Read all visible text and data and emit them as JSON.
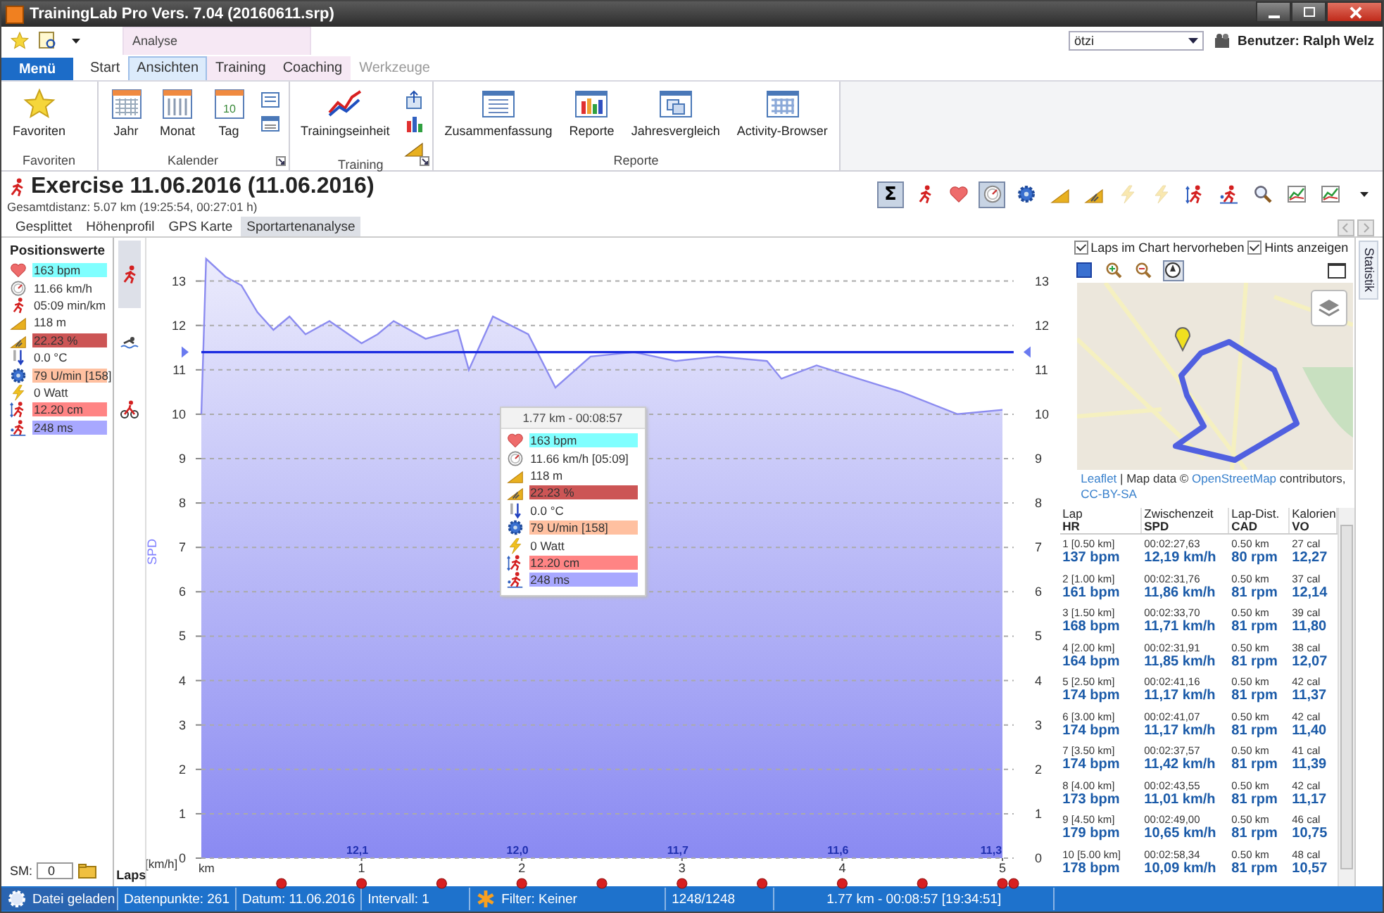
{
  "window": {
    "title": "TrainingLab Pro Vers. 7.04 (20160611.srp)"
  },
  "ribbon": {
    "context_group": "Analyse",
    "menu_button": "Menü",
    "tabs": [
      {
        "label": "Start",
        "selected": false,
        "disabled": false
      },
      {
        "label": "Ansichten",
        "selected": true,
        "disabled": false
      },
      {
        "label": "Training",
        "selected": false,
        "disabled": false
      },
      {
        "label": "Coaching",
        "selected": false,
        "disabled": false
      },
      {
        "label": "Werkzeuge",
        "selected": false,
        "disabled": true
      }
    ],
    "athlete_select": {
      "value": "ötzi"
    },
    "user": "Benutzer: Ralph Welz",
    "groups": [
      {
        "title": "Favoriten",
        "launcher": false,
        "buttons": [
          {
            "kind": "star",
            "label": "Favoriten"
          }
        ]
      },
      {
        "title": "Kalender",
        "launcher": true,
        "buttons": [
          {
            "kind": "year",
            "label": "Jahr"
          },
          {
            "kind": "month",
            "label": "Monat"
          },
          {
            "kind": "day",
            "label": "Tag",
            "icon_text": "10"
          }
        ],
        "small_buttons": [
          {
            "kind": "list"
          },
          {
            "kind": "week"
          }
        ]
      },
      {
        "title": "Training",
        "launcher": true,
        "buttons": [
          {
            "kind": "training",
            "label": "Trainingseinheit"
          }
        ],
        "small_buttons": [
          {
            "kind": "upload"
          },
          {
            "kind": "bars"
          },
          {
            "kind": "slope"
          }
        ]
      },
      {
        "title": "Reporte",
        "launcher": false,
        "buttons": [
          {
            "kind": "summary",
            "label": "Zusammenfassung"
          },
          {
            "kind": "reports",
            "label": "Reporte"
          },
          {
            "kind": "compare",
            "label": "Jahresvergleich"
          },
          {
            "kind": "browser",
            "label": "Activity-Browser"
          }
        ]
      }
    ]
  },
  "heading": {
    "title": "Exercise 11.06.2016 (11.06.2016)",
    "subtitle": "Gesamtdistanz: 5.07 km (19:25:54, 00:27:01 h)"
  },
  "toolbar": [
    {
      "kind": "sum",
      "label": "Σ",
      "selected": true,
      "disabled": false
    },
    {
      "kind": "run",
      "selected": false,
      "disabled": false
    },
    {
      "kind": "heart",
      "selected": false,
      "disabled": false
    },
    {
      "kind": "speed",
      "selected": true,
      "disabled": false
    },
    {
      "kind": "cadence",
      "selected": false,
      "disabled": false
    },
    {
      "kind": "altitude",
      "selected": false,
      "disabled": false
    },
    {
      "kind": "slope",
      "selected": false,
      "disabled": false
    },
    {
      "kind": "power",
      "selected": false,
      "disabled": true
    },
    {
      "kind": "power",
      "selected": false,
      "disabled": true
    },
    {
      "kind": "stride",
      "selected": false,
      "disabled": false
    },
    {
      "kind": "contact",
      "selected": false,
      "disabled": false
    },
    {
      "kind": "zoom",
      "selected": false,
      "disabled": false
    },
    {
      "kind": "chart",
      "selected": false,
      "disabled": false
    },
    {
      "kind": "chart",
      "selected": false,
      "disabled": false
    },
    {
      "kind": "more",
      "selected": false,
      "disabled": false
    }
  ],
  "view_tabs": [
    {
      "label": "Gesplittet",
      "selected": false
    },
    {
      "label": "Höhenprofil",
      "selected": false
    },
    {
      "label": "GPS Karte",
      "selected": false
    },
    {
      "label": "Sportartenanalyse",
      "selected": true
    }
  ],
  "position_values": {
    "title": "Positionswerte",
    "rows": [
      {
        "kind": "heart",
        "value": "163 bpm",
        "color": "#80ffff"
      },
      {
        "kind": "speed",
        "value": "11.66 km/h"
      },
      {
        "kind": "pace",
        "value": "05:09 min/km"
      },
      {
        "kind": "altitude",
        "value": "118 m"
      },
      {
        "kind": "slope",
        "value": "22.23 %",
        "color": "#cc5555"
      },
      {
        "kind": "temp",
        "value": "0.0 °C"
      },
      {
        "kind": "cadence",
        "value": "79 U/min [158]",
        "color": "#ffc0a0"
      },
      {
        "kind": "power",
        "value": "0 Watt"
      },
      {
        "kind": "stride",
        "value": "12.20 cm",
        "color": "#ff8484"
      },
      {
        "kind": "contact",
        "value": "248 ms",
        "color": "#a8a8ff"
      }
    ]
  },
  "sm": {
    "label": "SM:",
    "value": "0"
  },
  "sport_filters": [
    {
      "kind": "run",
      "selected": true
    },
    {
      "kind": "swim",
      "selected": false
    },
    {
      "kind": "bike",
      "selected": false
    }
  ],
  "chart": {
    "unit_label": "[km/h]",
    "laps_label": "Laps",
    "right_ticks": [
      "13",
      "12",
      "11",
      "10",
      "9",
      "8",
      "7",
      "6",
      "5",
      "4",
      "3",
      "2",
      "1",
      "0"
    ],
    "segment_averages": [
      "12,1",
      "12,0",
      "11,7",
      "11,6",
      "11,3"
    ],
    "chart_data": {
      "type": "line",
      "xlabel": "km",
      "ylabel": "SPD",
      "x": [
        0,
        0.03,
        0.15,
        0.25,
        0.35,
        0.45,
        0.55,
        0.65,
        0.8,
        1.0,
        1.1,
        1.2,
        1.4,
        1.6,
        1.67,
        1.82,
        2.04,
        2.21,
        2.43,
        2.7,
        2.96,
        3.22,
        3.53,
        3.62,
        3.84,
        4.1,
        4.37,
        4.72,
        5.0
      ],
      "series": [
        {
          "color": "#8c8cf0",
          "values": [
            10.0,
            13.5,
            13.1,
            12.9,
            12.3,
            11.9,
            12.2,
            11.8,
            12.1,
            11.6,
            11.8,
            12.1,
            11.7,
            11.9,
            11.0,
            12.2,
            11.8,
            10.6,
            11.3,
            11.4,
            11.2,
            11.3,
            11.2,
            10.8,
            11.1,
            10.8,
            10.5,
            10.0,
            10.1
          ]
        }
      ],
      "xlim": [
        0,
        5.07
      ],
      "ylim": [
        0,
        13.5
      ],
      "grid": true,
      "xticks": [
        1,
        2,
        3,
        4,
        5
      ],
      "yticks": [
        0,
        1,
        2,
        3,
        4,
        5,
        6,
        7,
        8,
        9,
        10,
        11,
        12,
        13
      ],
      "ref_lines": [
        {
          "axis": "y",
          "value": 11.4
        }
      ]
    }
  },
  "tooltip": {
    "title": "1.77 km - 00:08:57",
    "rows": [
      {
        "kind": "heart",
        "value": "163 bpm",
        "color": "#80ffff"
      },
      {
        "kind": "speed",
        "value": "11.66 km/h [05:09]"
      },
      {
        "kind": "altitude",
        "value": "118 m"
      },
      {
        "kind": "slope",
        "value": "22.23 %",
        "color": "#cc5555"
      },
      {
        "kind": "temp",
        "value": "0.0 °C"
      },
      {
        "kind": "cadence",
        "value": "79 U/min [158]",
        "color": "#ffc0a0"
      },
      {
        "kind": "power",
        "value": "0 Watt"
      },
      {
        "kind": "stride",
        "value": "12.20 cm",
        "color": "#ff8484"
      },
      {
        "kind": "contact",
        "value": "248 ms",
        "color": "#a8a8ff"
      }
    ]
  },
  "laps_panel": {
    "options": [
      {
        "label": "Laps im Chart hervorheben",
        "checked": true
      },
      {
        "label": "Hints anzeigen",
        "checked": true
      }
    ],
    "map_tools": [
      {
        "kind": "select",
        "selected": false
      },
      {
        "kind": "zoom-in",
        "selected": false
      },
      {
        "kind": "zoom-out",
        "selected": false
      },
      {
        "kind": "compass",
        "selected": true
      }
    ],
    "map_attribution": [
      {
        "text": "Leaflet",
        "link": true
      },
      {
        "text": " | Map data © ",
        "link": false
      },
      {
        "text": "OpenStreetMap",
        "link": true
      },
      {
        "text": " contributors, ",
        "link": false
      },
      {
        "text": "CC-BY-SA",
        "link": true
      }
    ],
    "table": {
      "columns": [
        {
          "top": "Lap",
          "bottom": "HR"
        },
        {
          "top": "Zwischenzeit",
          "bottom": "SPD"
        },
        {
          "top": "Lap-Dist.",
          "bottom": "CAD"
        },
        {
          "top": "Kalorien",
          "bottom": "VO"
        }
      ],
      "rows": [
        {
          "lap": "1  [0.50 km]",
          "time": "00:02:27,63",
          "dist": "0.50 km",
          "cal": "27 cal",
          "hr": "137 bpm",
          "spd": "12,19 km/h",
          "cad": "80 rpm",
          "vo": "12,27"
        },
        {
          "lap": "2  [1.00 km]",
          "time": "00:02:31,76",
          "dist": "0.50 km",
          "cal": "37 cal",
          "hr": "161 bpm",
          "spd": "11,86 km/h",
          "cad": "81 rpm",
          "vo": "12,14"
        },
        {
          "lap": "3  [1.50 km]",
          "time": "00:02:33,70",
          "dist": "0.50 km",
          "cal": "39 cal",
          "hr": "168 bpm",
          "spd": "11,71 km/h",
          "cad": "81 rpm",
          "vo": "11,80"
        },
        {
          "lap": "4  [2.00 km]",
          "time": "00:02:31,91",
          "dist": "0.50 km",
          "cal": "38 cal",
          "hr": "164 bpm",
          "spd": "11,85 km/h",
          "cad": "81 rpm",
          "vo": "12,07"
        },
        {
          "lap": "5  [2.50 km]",
          "time": "00:02:41,16",
          "dist": "0.50 km",
          "cal": "42 cal",
          "hr": "174 bpm",
          "spd": "11,17 km/h",
          "cad": "81 rpm",
          "vo": "11,37"
        },
        {
          "lap": "6  [3.00 km]",
          "time": "00:02:41,07",
          "dist": "0.50 km",
          "cal": "42 cal",
          "hr": "174 bpm",
          "spd": "11,17 km/h",
          "cad": "81 rpm",
          "vo": "11,40"
        },
        {
          "lap": "7  [3.50 km]",
          "time": "00:02:37,57",
          "dist": "0.50 km",
          "cal": "41 cal",
          "hr": "174 bpm",
          "spd": "11,42 km/h",
          "cad": "81 rpm",
          "vo": "11,39"
        },
        {
          "lap": "8  [4.00 km]",
          "time": "00:02:43,55",
          "dist": "0.50 km",
          "cal": "42 cal",
          "hr": "173 bpm",
          "spd": "11,01 km/h",
          "cad": "81 rpm",
          "vo": "11,17"
        },
        {
          "lap": "9  [4.50 km]",
          "time": "00:02:49,00",
          "dist": "0.50 km",
          "cal": "46 cal",
          "hr": "179 bpm",
          "spd": "10,65 km/h",
          "cad": "81 rpm",
          "vo": "10,75"
        },
        {
          "lap": "10  [5.00 km]",
          "time": "00:02:58,34",
          "dist": "0.50 km",
          "cal": "48 cal",
          "hr": "178 bpm",
          "spd": "10,09 km/h",
          "cad": "81 rpm",
          "vo": "10,57"
        }
      ]
    }
  },
  "side_tab": "Statistik",
  "status_bar": {
    "items": [
      {
        "kind": "loaded",
        "text": "Datei geladen"
      },
      {
        "kind": "text",
        "text": "Datenpunkte: 261"
      },
      {
        "kind": "text",
        "text": "Datum: 11.06.2016"
      },
      {
        "kind": "text",
        "text": "Intervall: 1"
      },
      {
        "kind": "filter",
        "text": "Filter: Keiner"
      },
      {
        "kind": "text",
        "text": "1248/1248"
      },
      {
        "kind": "wide",
        "text": "1.77 km - 00:08:57 [19:34:51]"
      }
    ]
  }
}
